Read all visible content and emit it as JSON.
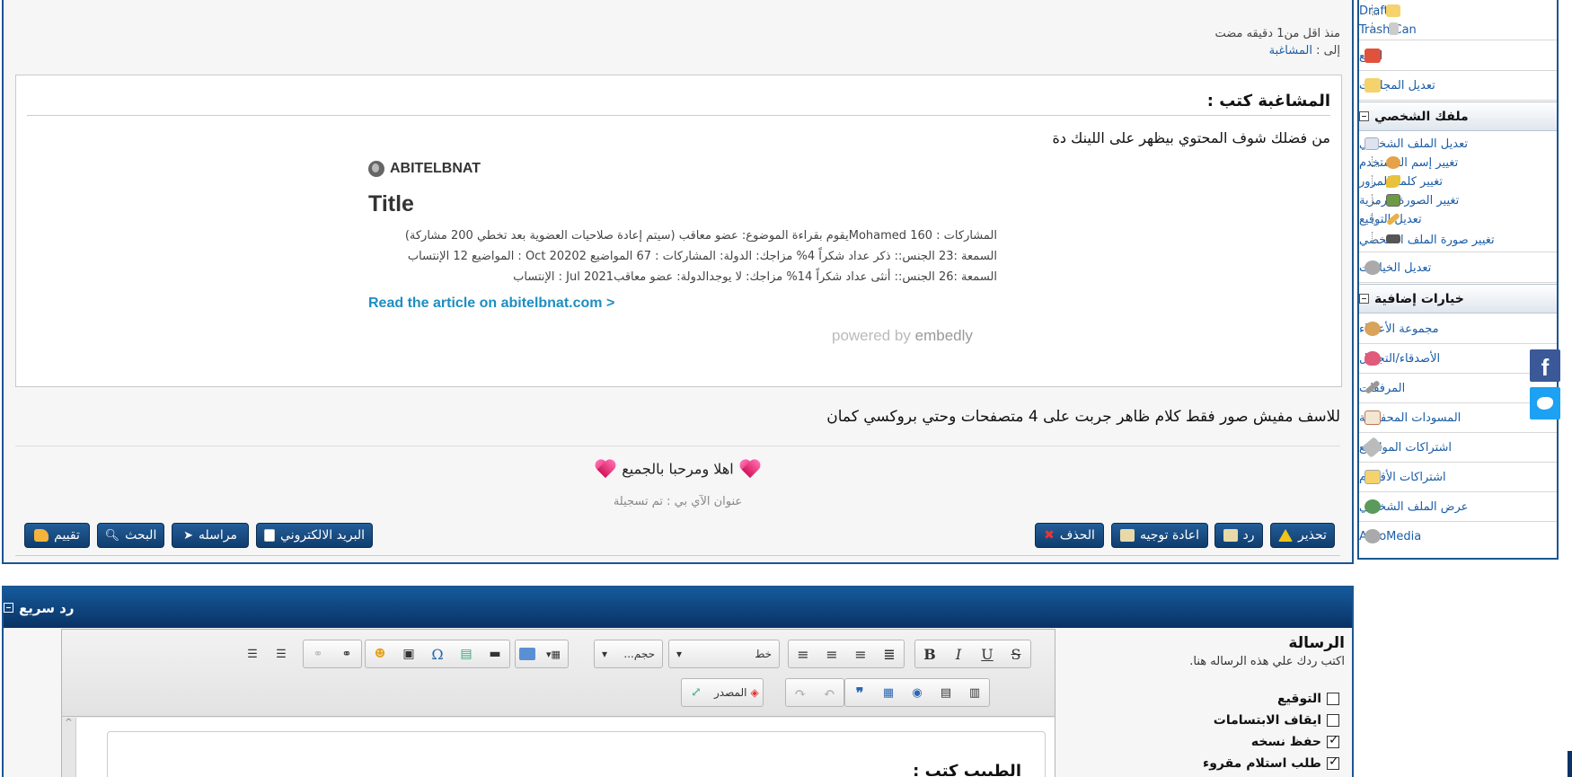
{
  "post": {
    "time_ago": "منذ اقل من1 دقيقه مضت",
    "to_label": "إلى :",
    "to_user": "المشاغبة",
    "quote_author": "المشاغبة كتب :",
    "quote_text": "من فضلك شوف المحتوي بيظهر على اللينك دة",
    "embed": {
      "site": "ABITELBNAT",
      "title": "Title",
      "line1": "المشاركات : 160 Mohamedيقوم بقراءة الموضوع: عضو معاقب (سيتم إعادة صلاحيات العضوية بعد تخطي 200 مشاركة)",
      "line2": "السمعة :23 الجنس:: ذكر عداد شكراً 4% مزاجك: الدولة: المشاركات : 67 المواضيع Oct 20202 : المواضيع 12 الإنتساب",
      "line3": "السمعة :26 الجنس:: أنثى عداد شكراً 14% مزاجك: لا يوجدالدولة: عضو معاقبJul 2021 : الإنتساب",
      "link": "Read the article on abitelbnat.com >",
      "powered_by": "powered by",
      "powered_brand": "embedly"
    },
    "body_text": "للاسف مفيش صور فقط كلام ظاهر جربت على 4 متصفحات وحتي بروكسي كمان",
    "greeting": "اهلا ومرحبا بالجميع",
    "signature": "عنوان الآي بي : تم تسجيلة",
    "buttons_right": [
      "تحذير",
      "رد",
      "اعادة توجيه",
      "الحذف"
    ],
    "buttons_left": [
      "البريد الالكتروني",
      "مراسله",
      "البحث",
      "تقييم"
    ]
  },
  "sidebar": {
    "drafts": "Drafts",
    "trash": "Trash Can",
    "follow": "التتبع",
    "edit_folders": "تعديل المجلدات",
    "profile_header": "ملفك الشخصي",
    "profile_items": [
      "تعديل الملف الشخصي",
      "تغيير إسم المستخدم",
      "تغيير كلمة المرور",
      "تغيير الصورة الرمزية",
      "تعديل التوقيع",
      "تغيير صورة الملف الشخصي"
    ],
    "edit_options": "تعديل الخيارات",
    "extra_header": "خيارات إضافية",
    "extra_items": [
      "مجموعة الأعضاء",
      "الأصدقاء/التجاهل",
      "المرفقات",
      "المسودات المحفوظة",
      "اشتراكات المواضيع",
      "اشتراكات الأقسام",
      "عرض الملف الشخصي",
      "AutoMedia"
    ]
  },
  "quick_reply": {
    "header": "رد سريع",
    "message_label": "الرسالة",
    "message_hint": "اكتب ردك علي هذه الرساله هنا.",
    "options": [
      {
        "label": "التوقيع",
        "checked": false
      },
      {
        "label": "ايقاف الابتسامات",
        "checked": false
      },
      {
        "label": "حفظ نسخه",
        "checked": true
      },
      {
        "label": "طلب استلام مقروء",
        "checked": true
      }
    ],
    "font_select": "خط",
    "size_select": "حجم...",
    "source_button": "المصدر",
    "editor_quote_author": "الطبيب كتب :",
    "scroll_up": "^"
  }
}
